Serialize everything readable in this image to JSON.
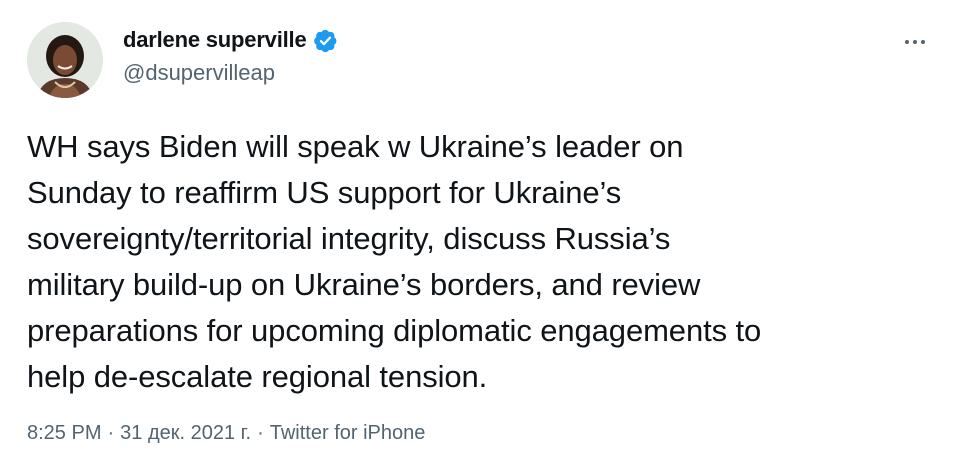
{
  "author": {
    "display_name": "darlene superville",
    "handle": "@dsupervilleap",
    "verified": true,
    "verified_icon": "verified-badge-icon",
    "avatar_icon": "profile-photo"
  },
  "more_icon": "more-options-icon",
  "tweet": {
    "lines": [
      "WH says Biden will speak w Ukraine’s leader on",
      "Sunday to reaffirm US support for Ukraine’s",
      "sovereignty/territorial integrity, discuss Russia’s",
      "military build-up on Ukraine’s borders, and review",
      "preparations for upcoming diplomatic engagements to",
      "help de-escalate regional tension."
    ]
  },
  "meta": {
    "time": "8:25 PM",
    "date": "31 дек. 2021 г.",
    "source": "Twitter for iPhone",
    "separator": "·"
  },
  "colors": {
    "text": "#0f1419",
    "secondary": "#536471",
    "verified": "#1d9bf0",
    "background": "#ffffff"
  }
}
